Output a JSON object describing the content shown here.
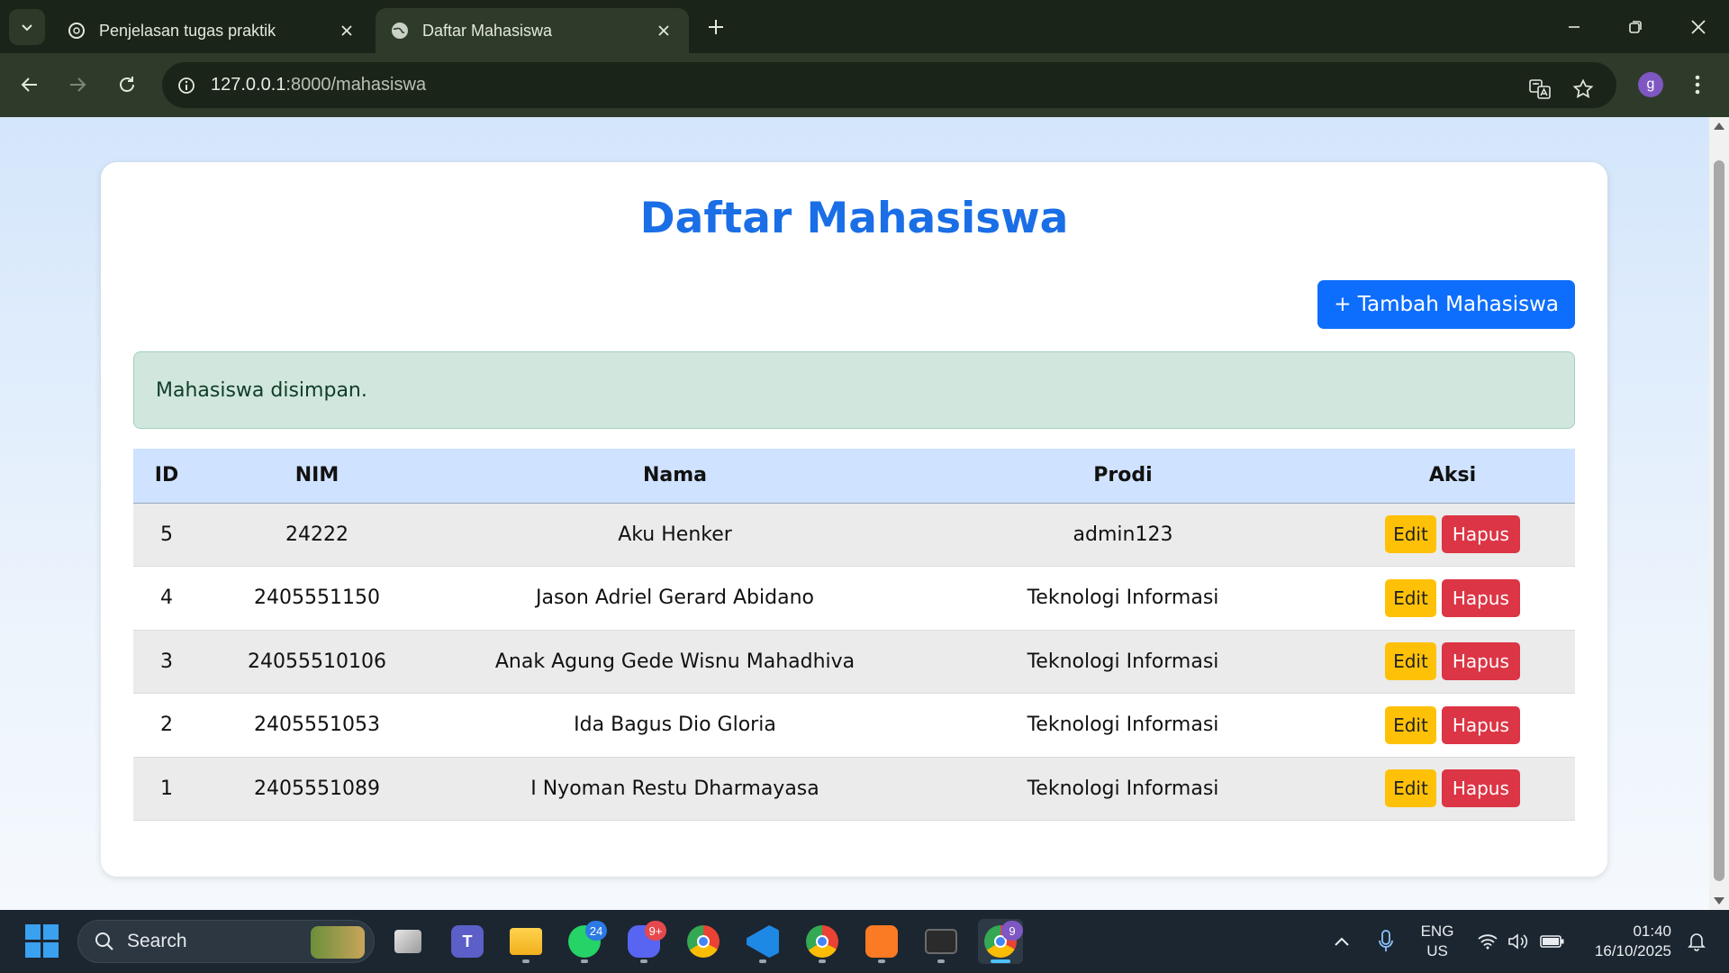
{
  "browser": {
    "tabs": [
      {
        "title": "Penjelasan tugas praktik",
        "active": false,
        "icon": "chatgpt-icon"
      },
      {
        "title": "Daftar Mahasiswa",
        "active": true,
        "icon": "globe-icon"
      }
    ],
    "url_host": "127.0.0.1",
    "url_path": ":8000/mahasiswa",
    "profile_initial": "g"
  },
  "page": {
    "title": "Daftar Mahasiswa",
    "add_button": "+ Tambah Mahasiswa",
    "alert": "Mahasiswa disimpan.",
    "table": {
      "headers": [
        "ID",
        "NIM",
        "Nama",
        "Prodi",
        "Aksi"
      ],
      "rows": [
        {
          "id": "5",
          "nim": "24222",
          "nama": "Aku Henker",
          "prodi": "admin123"
        },
        {
          "id": "4",
          "nim": "2405551150",
          "nama": "Jason Adriel Gerard Abidano",
          "prodi": "Teknologi Informasi"
        },
        {
          "id": "3",
          "nim": "24055510106",
          "nama": "Anak Agung Gede Wisnu Mahadhiva",
          "prodi": "Teknologi Informasi"
        },
        {
          "id": "2",
          "nim": "2405551053",
          "nama": "Ida Bagus Dio Gloria",
          "prodi": "Teknologi Informasi"
        },
        {
          "id": "1",
          "nim": "2405551089",
          "nama": "I Nyoman Restu Dharmayasa",
          "prodi": "Teknologi Informasi"
        }
      ],
      "edit_label": "Edit",
      "delete_label": "Hapus"
    }
  },
  "colors": {
    "title": "#1a6ee6",
    "primary": "#0d6efd",
    "alert_bg": "#d1e7dd",
    "header_bg": "#cfe2ff",
    "edit": "#ffc107",
    "delete": "#dc3545"
  },
  "taskbar": {
    "search_placeholder": "Search",
    "whatsapp_badge": "24",
    "discord_badge": "9+",
    "chrome_badge": "9",
    "lang_line1": "ENG",
    "lang_line2": "US",
    "time": "01:40",
    "date": "16/10/2025"
  }
}
